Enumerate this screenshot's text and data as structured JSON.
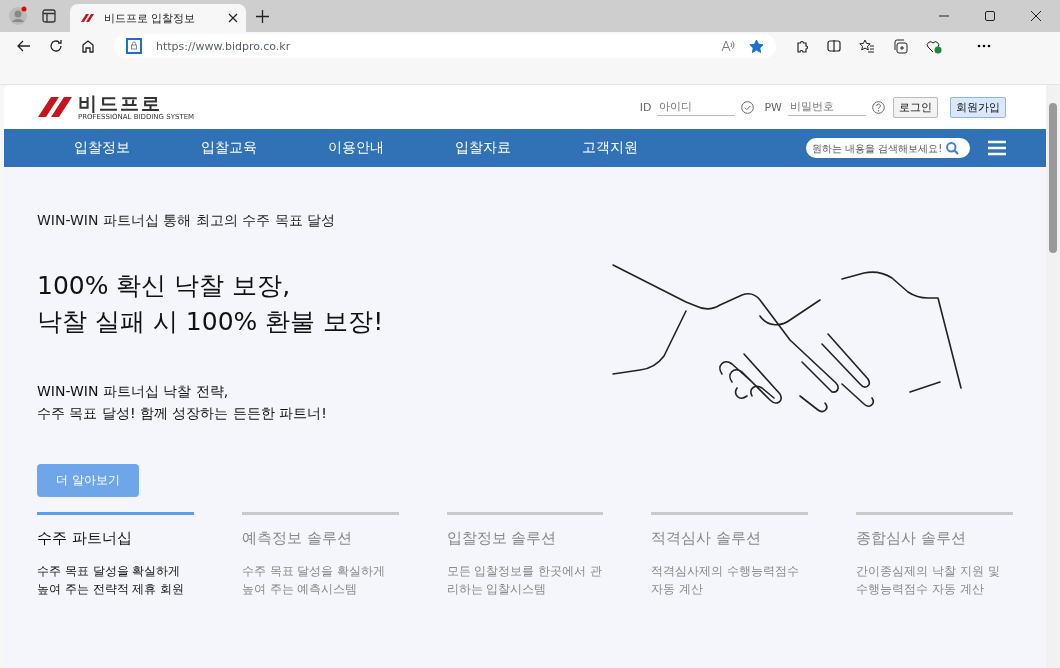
{
  "browser": {
    "tab_title": "비드프로 입찰정보",
    "url": "https://www.bidpro.co.kr",
    "favorite": true
  },
  "header": {
    "logo_text": "비드프로",
    "logo_tagline": "PROFESSIONAL BIDDING SYSTEM",
    "id_label": "ID",
    "id_placeholder": "아이디",
    "pw_label": "PW",
    "pw_placeholder": "비밀번호",
    "buttons": [
      {
        "label": "로그인",
        "kind": "plain"
      },
      {
        "label": "회원가입",
        "kind": "primary"
      }
    ]
  },
  "nav": {
    "items": [
      "입찰정보",
      "입찰교육",
      "이용안내",
      "입찰자료",
      "고객지원"
    ],
    "search_placeholder": "원하는 내용을 검색해보세요!"
  },
  "hero": {
    "eyebrow": "WIN-WIN 파트너십 통해 최고의 수주 목표 달성",
    "headline": [
      "100% 확신 낙찰 보장,",
      "낙찰 실패 시 100% 환불 보장!"
    ],
    "subtext": [
      "WIN-WIN 파트너십 낙찰 전략,",
      "수주 목표 달성! 함께 성장하는 든든한 파트너!"
    ],
    "cta": "더 알아보기"
  },
  "features": [
    {
      "title": "수주 파트너십",
      "description": "수주 목표 달성을 확실하게 높여 주는 전략적 제휴 회원",
      "selected": true
    },
    {
      "title": "예측정보 솔루션",
      "description": "수주 목표 달성을 확실하게 높여 주는 예측시스템",
      "selected": false
    },
    {
      "title": "입찰정보 솔루션",
      "description": "모든 입찰정보를 한곳에서 관리하는 입찰시스템",
      "selected": false
    },
    {
      "title": "적격심사 솔루션",
      "description": "적격심사제의 수행능력점수 자동 계산",
      "selected": false
    },
    {
      "title": "종합심사 솔루션",
      "description": "간이종심제의 낙찰 지원 및 수행능력점수 자동 계산",
      "selected": false
    }
  ]
}
